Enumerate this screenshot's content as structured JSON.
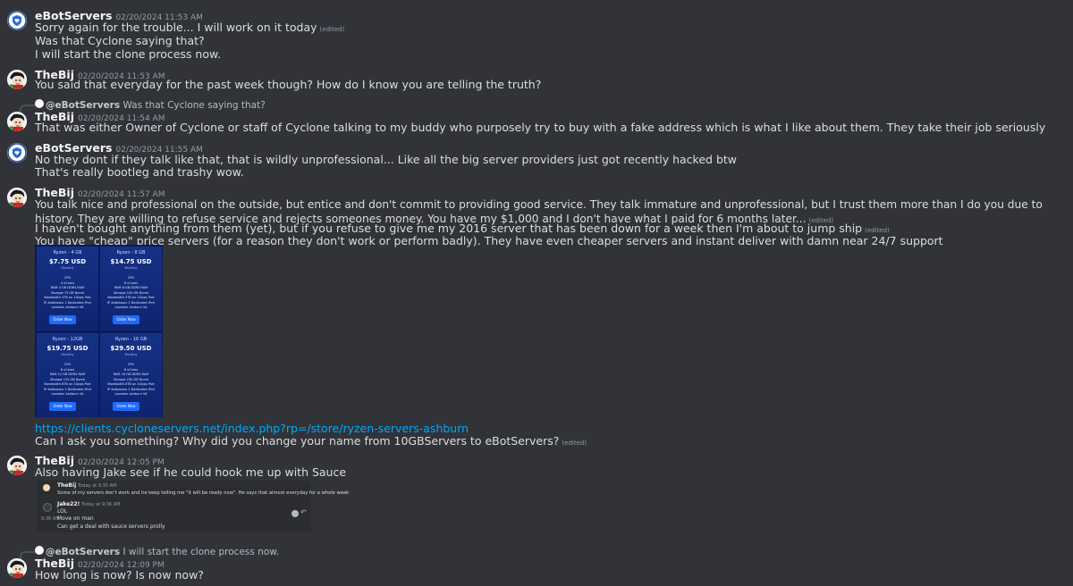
{
  "messages": [
    {
      "author": "eBotServers",
      "timestamp": "02/20/2024 11:53 AM",
      "lines": [
        {
          "text": "Sorry again for the trouble... I will work on it today",
          "edited": "(edited)"
        },
        {
          "text": "Was that Cyclone saying that?"
        },
        {
          "text": "I will start the clone process now."
        }
      ]
    },
    {
      "author": "TheBij",
      "timestamp": "02/20/2024 11:53 AM",
      "lines": [
        {
          "text": "You said that everyday for the past week though?  How do I know you are telling the truth?"
        }
      ]
    },
    {
      "reply": {
        "author": "@eBotServers",
        "text": "Was that Cyclone saying that?"
      },
      "author": "TheBij",
      "timestamp": "02/20/2024 11:54 AM",
      "lines": [
        {
          "text": "That was either Owner of Cyclone or staff of Cyclone talking to my buddy who purposely try to buy with a fake address which is what I like about them. They take their job seriously"
        }
      ]
    },
    {
      "author": "eBotServers",
      "timestamp": "02/20/2024 11:55 AM",
      "lines": [
        {
          "text": "No they dont if they talk like that, that is wildly unprofessional... Like all the big server providers just got recently hacked btw"
        },
        {
          "text": "That's really bootleg and trashy wow."
        }
      ]
    },
    {
      "author": "TheBij",
      "timestamp": "02/20/2024 11:57 AM",
      "lines": [
        {
          "text": "You talk nice and professional on the outside, but entice and don't commit to providing good service. They talk immature and unprofessional, but I trust them more than I do you due to history. They are willing to refuse service and rejects someones money. You have my $1,000 and I don't have what I paid for 6 months later...",
          "edited": "(edited)"
        },
        {
          "text": "I haven't bought anything from them (yet), but if you refuse to give me my 2016 server that has been down for a week then I'm about to jump ship",
          "edited": "(edited)"
        },
        {
          "text": "You have \"cheap\" price servers (for a reason they don't work or perform badly). They have even cheaper servers and instant deliver with damn near 24/7 support"
        }
      ],
      "link": "https://clients.cycloneservers.net/index.php?rp=/store/ryzen-servers-ashburn",
      "after_link": {
        "text": "Can I ask you something? Why did you change your name from 10GBServers to eBotServers?",
        "edited": "(edited)"
      }
    },
    {
      "author": "TheBij",
      "timestamp": "02/20/2024 12:05 PM",
      "lines": [
        {
          "text": "Also having Jake see if he could hook me up with Sauce"
        }
      ]
    },
    {
      "reply": {
        "author": "@eBotServers",
        "text": "I will start the clone process now."
      },
      "author": "TheBij",
      "timestamp": "02/20/2024 12:09 PM",
      "lines": [
        {
          "text": "How long is now?  Is now now?"
        }
      ]
    }
  ],
  "pricing": [
    {
      "name": "Ryzen - 4 GB",
      "price": "$7.75 USD",
      "period": "Monthly",
      "specs": [
        "CPU",
        "4 vCores",
        "RAM 4 GB DDR4 RAM",
        "Storage 75 GB Nvme",
        "Bandwidth 4TB on 1Gbps Port",
        "IP Addresses 1 Dedicated IPv4",
        "Location Ashburn VA"
      ],
      "button": "Order Now"
    },
    {
      "name": "Ryzen - 8 GB",
      "price": "$14.75 USD",
      "period": "Monthly",
      "specs": [
        "CPU",
        "6 vCores",
        "RAM 8 GB DDR4 RAM",
        "Storage 100 GB Nvme",
        "Bandwidth 5TB on 1Gbps Port",
        "IP Addresses 1 Dedicated IPv4",
        "Location Ashburn VA"
      ],
      "button": "Order Now"
    },
    {
      "name": "Ryzen - 12GB",
      "price": "$19.75 USD",
      "period": "Monthly",
      "specs": [
        "CPU",
        "8 vCores",
        "RAM 12 GB DDR4 RAM",
        "Storage 125 GB Nvme",
        "Bandwidth 6TB on 1Gbps Port",
        "IP Addresses 1 Dedicated IPv4",
        "Location Ashburn VA"
      ],
      "button": "Order Now"
    },
    {
      "name": "Ryzen - 16 GB",
      "price": "$29.50 USD",
      "period": "Monthly",
      "specs": [
        "CPU",
        "8 vCores",
        "RAM 16 GB DDR4 RAM",
        "Storage 150 GB Nvme",
        "Bandwidth 8TB on 1Gbps Port",
        "IP Addresses 1 Dedicated IPv4",
        "Location Ashburn VA"
      ],
      "button": "Order Now"
    }
  ],
  "embed": {
    "msg1": {
      "author": "TheBij",
      "time": "Today at 9:35 AM",
      "text": "Some of my servers don't work and he keep telling me \"it will be ready now\". He says that almost everyday for a whole week"
    },
    "msg2": {
      "author": "Jake22!",
      "time": "Today at 9:36 AM",
      "lines": [
        "LOL",
        "Move on man",
        "Can get a deal with sauce servers prolly"
      ],
      "side_time": "9:36 AM"
    }
  }
}
